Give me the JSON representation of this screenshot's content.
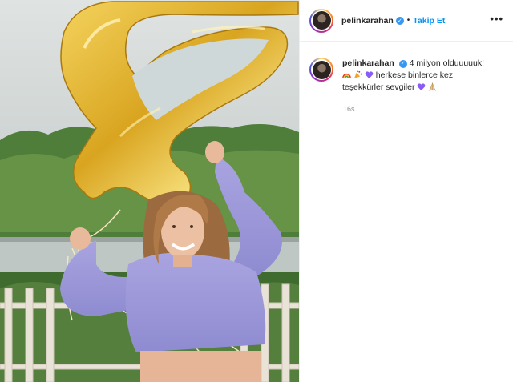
{
  "post": {
    "username": "pelinkarahan",
    "verified": true,
    "separator": "•",
    "follow_label": "Takip Et",
    "more_label": "•••",
    "caption": {
      "headline": "4 milyon olduuuuuk!",
      "line2": "herkese binlerce kez",
      "line3": "teşekkürler sevgiler"
    },
    "timestamp": "16s"
  },
  "icons": {
    "verified": "verified-badge-icon",
    "rainbow": "rainbow-emoji-icon",
    "party": "party-popper-emoji-icon",
    "heart": "purple-heart-emoji-icon",
    "pray": "folded-hands-emoji-icon"
  },
  "colors": {
    "accent": "#0095f6",
    "text": "#262626",
    "muted": "#8e8e8e",
    "balloon": "#e0b531",
    "heart": "#8a5cf6"
  }
}
